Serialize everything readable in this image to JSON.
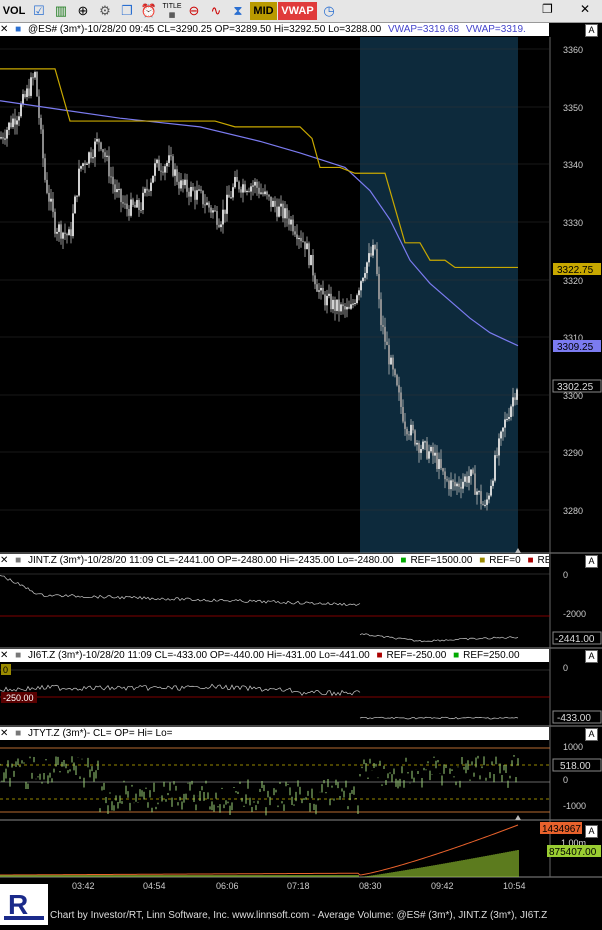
{
  "toolbar": {
    "vol_label": "VOL",
    "title_label": "TITLE",
    "mid_label": "MID",
    "vwap_label": "VWAP",
    "icons": [
      "checkbox-icon",
      "candles-icon",
      "zoom-icon",
      "gear-icon",
      "windows-icon",
      "alarm-icon",
      "title-icon",
      "minus-plus-icon",
      "sine-icon",
      "hourglass-icon",
      "clock-icon"
    ]
  },
  "price_panel": {
    "header": [
      "@ES# (3m*)-10/28/20 09:45 CL=3290.25 OP=3289.50 Hi=3292.50 Lo=3288.00",
      "VWAP=3319.68",
      "VWAP=3319."
    ],
    "colors": {
      "vwap_blue": "#7b7bf0",
      "vwap_gold": "#c8a800",
      "shade": "#0d2a3c",
      "candle": "#d0d0d0"
    },
    "y_ticks": [
      "3360",
      "3350",
      "3340",
      "3330",
      "3320",
      "3310",
      "3300",
      "3290",
      "3280"
    ],
    "tags": {
      "gold": "3322.75",
      "blue": "3309.25",
      "last": "3302.25"
    }
  },
  "jint_panel": {
    "header": [
      "JINT.Z (3m*)-10/28/20 11:09 CL=-2441.00 OP=-2480.00 Hi=-2435.00 Lo=-2480.00",
      "REF=1500.00",
      "REF=0",
      "RE"
    ],
    "y_ticks": [
      "0",
      "-2000"
    ],
    "tag": "-2441.00"
  },
  "ji6t_panel": {
    "header": [
      "JI6T.Z (3m*)-10/28/20 11:09 CL=-433.00 OP=-440.00 Hi=-431.00 Lo=-441.00",
      "REF=-250.00",
      "REF=250.00"
    ],
    "y_ticks": [
      "0"
    ],
    "ref_tag": "-250.00",
    "zero_tag": "0",
    "tag": "-433.00"
  },
  "jtyt_panel": {
    "header": [
      "JTYT.Z (3m*)- CL= OP= Hi= Lo="
    ],
    "y_ticks": [
      "1000",
      "0",
      "-1000"
    ],
    "tag": "518.00"
  },
  "volume_panel": {
    "tags": {
      "red": "1434967",
      "label": "1.00m",
      "green": "875407.00"
    }
  },
  "x_axis": [
    "03:42",
    "04:54",
    "06:06",
    "07:18",
    "08:30",
    "09:42",
    "10:54"
  ],
  "footer": "Chart by Investor/RT, Linn Software, Inc. www.linnsoft.com - Average Volume: @ES# (3m*), JINT.Z (3m*), JI6T.Z",
  "panel_button": "A",
  "chart_data": [
    {
      "type": "line",
      "title": "@ES# (3m*)",
      "x": [
        "03:42",
        "04:54",
        "06:06",
        "07:18",
        "08:30",
        "09:42",
        "10:54"
      ],
      "ylim": [
        3275,
        3363
      ],
      "series": [
        {
          "name": "@ES#",
          "values": [
            3342,
            3340,
            3336,
            3330,
            3327,
            3285,
            3302
          ]
        },
        {
          "name": "VWAP",
          "values": [
            3348,
            3347,
            3346,
            3343,
            3338,
            3316,
            3309.25
          ]
        }
      ]
    },
    {
      "type": "line",
      "title": "JINT.Z (3m*)",
      "x": [
        "03:42",
        "04:54",
        "06:06",
        "07:18",
        "08:30",
        "09:42",
        "10:54"
      ],
      "series": [
        {
          "name": "JINT.Z",
          "values": [
            -500,
            -900,
            -1000,
            -1100,
            -2350,
            -2500,
            -2441
          ]
        }
      ]
    },
    {
      "type": "line",
      "title": "JI6T.Z (3m*)",
      "x": [
        "03:42",
        "04:54",
        "06:06",
        "07:18",
        "08:30",
        "09:42",
        "10:54"
      ],
      "series": [
        {
          "name": "JI6T.Z",
          "values": [
            60,
            20,
            30,
            -60,
            -420,
            -450,
            -433
          ]
        }
      ]
    },
    {
      "type": "line",
      "title": "JTYT.Z (3m*)",
      "x": [
        "03:42",
        "04:54",
        "06:06",
        "07:18",
        "08:30",
        "09:42",
        "10:54"
      ],
      "ylim": [
        -1200,
        1200
      ],
      "series": [
        {
          "name": "JTYT.Z",
          "values": [
            100,
            -300,
            -200,
            -300,
            400,
            300,
            518
          ]
        }
      ]
    },
    {
      "type": "area",
      "title": "Average Volume",
      "x": [
        "03:42",
        "04:54",
        "06:06",
        "07:18",
        "08:30",
        "09:42",
        "10:54"
      ],
      "series": [
        {
          "name": "red",
          "values": [
            0,
            5000,
            15000,
            40000,
            150000,
            900000,
            1434967
          ]
        },
        {
          "name": "green",
          "values": [
            0,
            5000,
            15000,
            40000,
            120000,
            500000,
            875407
          ]
        }
      ]
    }
  ]
}
